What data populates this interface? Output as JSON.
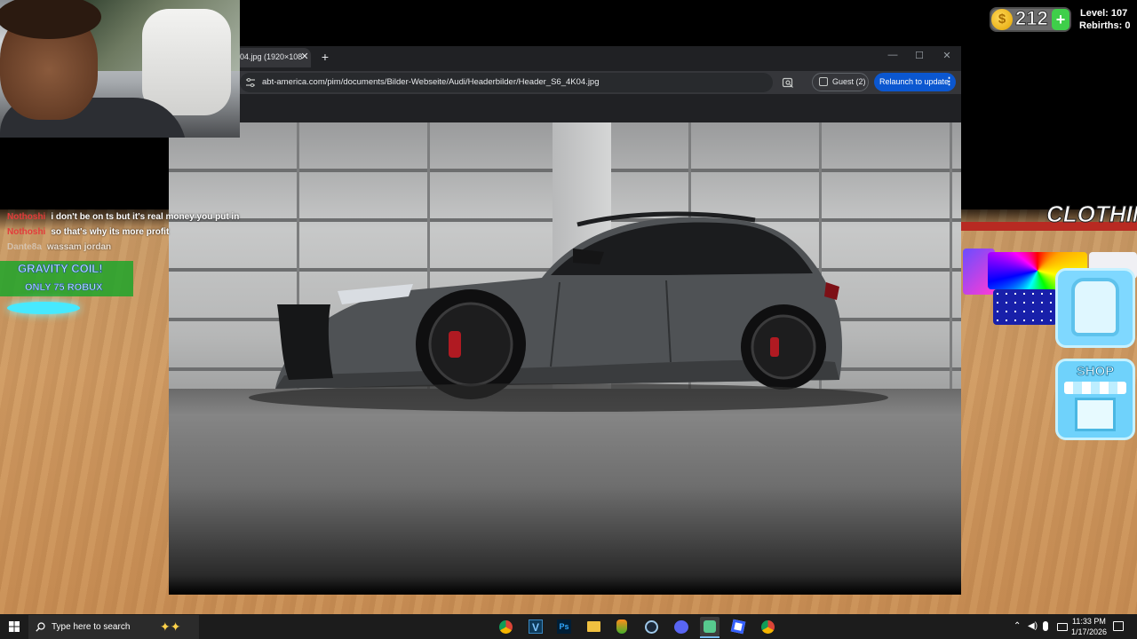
{
  "game": {
    "coins": "212",
    "coin_symbol": "$",
    "coin_add": "+",
    "level": "Level: 107",
    "rebirths": "Rebirths: 0",
    "clothing_sign": "CLOTHIN",
    "shop_label": "SHOP",
    "gravity_title": "GRAVITY COIL!",
    "gravity_price": "ONLY 75 ROBUX"
  },
  "chat": [
    {
      "user": "Nothoshi",
      "message": "i don't be on ts but it's real money you put in"
    },
    {
      "user": "Nothoshi",
      "message": "so that's why its more profit"
    },
    {
      "user": "Dante8a",
      "message": "wassam jordan"
    }
  ],
  "browser": {
    "tab_title": "04.jpg (1920×108",
    "tab_close": "✕",
    "new_tab": "+",
    "window_min": "—",
    "window_max": "☐",
    "window_close": "✕",
    "url": "abt-america.com/pim/documents/Bilder-Webseite/Audi/Headerbilder/Header_S6_4K04.jpg",
    "profile_label": "Guest (2)",
    "relaunch_label": "Relaunch to update",
    "menu": "⋮"
  },
  "taskbar": {
    "search_placeholder": "Type here to search",
    "time": "11:33 PM",
    "date": "1/17/2026",
    "apps": [
      "chrome-icon",
      "visual-studio-icon",
      "photoshop-icon",
      "file-explorer-icon",
      "fl-studio-icon",
      "steam-icon",
      "discord-icon",
      "chat-app-icon",
      "roblox-icon",
      "chrome-icon-2"
    ],
    "ps_text": "Ps",
    "vs_text": "V"
  },
  "colors": {
    "accent_blue": "#0b57d0",
    "chat_user": "#e33b3b",
    "coin_gold": "#e2a400"
  }
}
